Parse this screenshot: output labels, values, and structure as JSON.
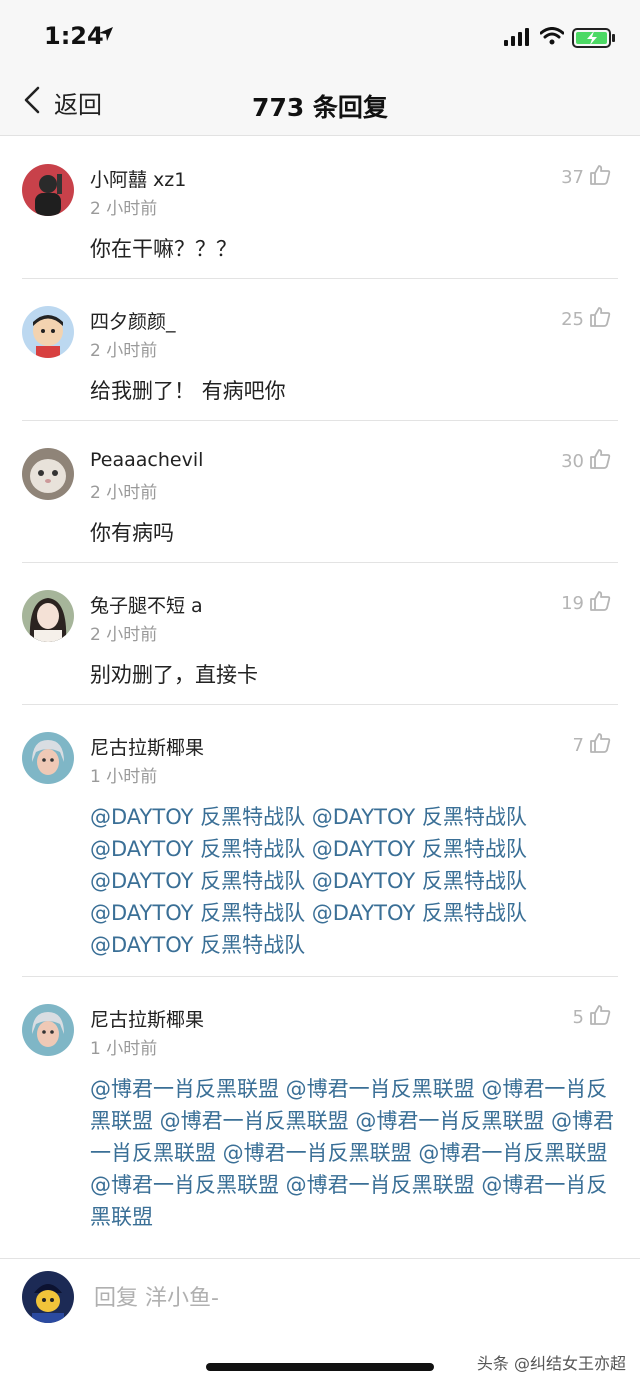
{
  "status_bar": {
    "time": "1:24",
    "icons": [
      "location-arrow-icon",
      "signal-icon",
      "wifi-icon",
      "battery-icon"
    ],
    "battery_color": "#4cd964"
  },
  "nav": {
    "back_label": "返回",
    "title": "773 条回复"
  },
  "colors": {
    "mention": "#3a6f96",
    "meta": "#9a9a9a",
    "like": "#b5b5b5"
  },
  "replies": [
    {
      "username": "小阿囍 xz1",
      "time": "2 小时前",
      "likes": "37",
      "content": "你在干嘛？？？"
    },
    {
      "username": "四夕颜颜_",
      "time": "2 小时前",
      "likes": "25",
      "content": "给我删了！ 有病吧你"
    },
    {
      "username": "Peaaachevil",
      "time": "2 小时前",
      "likes": "30",
      "content": "你有病吗"
    },
    {
      "username": "兔子腿不短 a",
      "time": "2 小时前",
      "likes": "19",
      "content": "别劝删了，直接卡"
    },
    {
      "username": "尼古拉斯椰果",
      "time": "1 小时前",
      "likes": "7",
      "content": "@DAYTOY 反黑特战队 @DAYTOY 反黑特战队 @DAYTOY 反黑特战队 @DAYTOY 反黑特战队 @DAYTOY 反黑特战队 @DAYTOY 反黑特战队 @DAYTOY 反黑特战队 @DAYTOY 反黑特战队 @DAYTOY 反黑特战队"
    },
    {
      "username": "尼古拉斯椰果",
      "time": "1 小时前",
      "likes": "5",
      "content": "@博君一肖反黑联盟 @博君一肖反黑联盟 @博君一肖反黑联盟 @博君一肖反黑联盟 @博君一肖反黑联盟 @博君一肖反黑联盟 @博君一肖反黑联盟 @博君一肖反黑联盟 @博君一肖反黑联盟 @博君一肖反黑联盟 @博君一肖反黑联盟"
    }
  ],
  "reply_bar": {
    "placeholder": "回复 洋小鱼-"
  },
  "watermark": "头条 @纠结女王亦超"
}
